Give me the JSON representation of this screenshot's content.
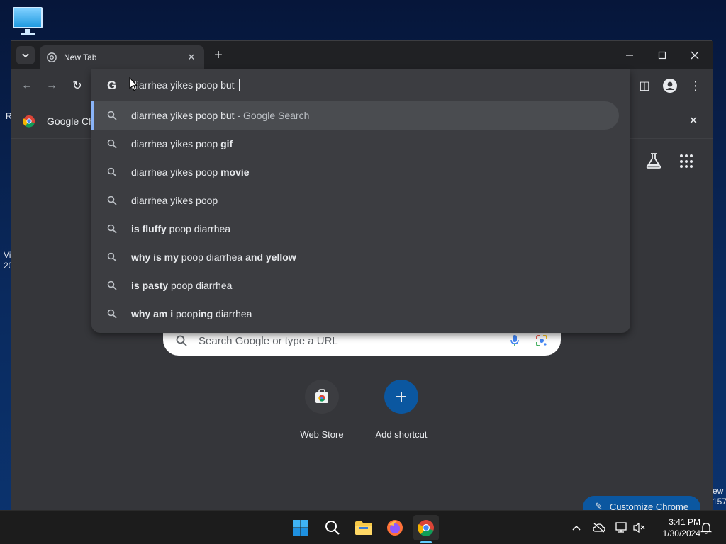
{
  "desktop": {
    "left_fragments": [
      "R",
      "Vi",
      "20"
    ],
    "right_fragments": [
      "ew",
      "157"
    ]
  },
  "tabs": [
    {
      "title": "New Tab"
    }
  ],
  "toolbar": {
    "back_label": "←",
    "forward_label": "→",
    "reload_label": "↻",
    "sidepanel_label": "◫",
    "menu_label": "⋮"
  },
  "omnibox": {
    "input_value": "diarrhea yikes poop but ",
    "suggestions": [
      {
        "plain_before": "diarrhea yikes poop but",
        "bold": "",
        "plain_after": "",
        "suffix": " - Google Search"
      },
      {
        "plain_before": "diarrhea yikes poop ",
        "bold": "gif",
        "plain_after": "",
        "suffix": ""
      },
      {
        "plain_before": "diarrhea yikes poop ",
        "bold": "movie",
        "plain_after": "",
        "suffix": ""
      },
      {
        "plain_before": "diarrhea yikes poop",
        "bold": "",
        "plain_after": "",
        "suffix": ""
      },
      {
        "bold_lead": "is fluffy",
        "plain": " poop diarrhea"
      },
      {
        "bold_lead": "why is my",
        "plain": " poop diarrhea ",
        "bold_tail": "and yellow"
      },
      {
        "bold_lead": "is pasty",
        "plain": " poop diarrhea"
      },
      {
        "bold_lead": "why am i",
        "plain": " poop",
        "bold_mid": "ing",
        "plain_tail": " diarrhea"
      }
    ]
  },
  "bookmark_bar": {
    "item_label": "Google Ch"
  },
  "ntp": {
    "search_placeholder": "Search Google or type a URL",
    "shortcuts": [
      {
        "label": "Web Store"
      },
      {
        "label": "Add shortcut"
      }
    ],
    "customize_label": "Customize Chrome"
  },
  "taskbar": {
    "time": "3:41 PM",
    "date": "1/30/2024"
  },
  "colors": {
    "accent": "#8ab4f8",
    "add_shortcut": "#0b57a0",
    "taskbar_indicator": "#60cdff"
  }
}
